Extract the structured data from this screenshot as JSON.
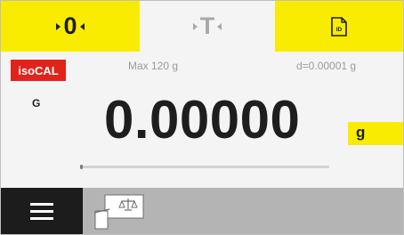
{
  "toolbar": {
    "zero_label": "0",
    "tare_label": "T",
    "id_label": "ID"
  },
  "status": {
    "isocal_label": "isoCAL",
    "max_capacity": "Max 120 g",
    "readability": "d=0.00001 g",
    "weighing_mode": "G"
  },
  "display": {
    "weight": "0.00000",
    "unit": "g",
    "capacity_used_fraction": 0.0
  },
  "colors": {
    "accent_yellow": "#f9ec00",
    "isocal_red": "#e2231a",
    "menu_dark": "#1c1c1c",
    "bottom_bar": "#b4b4b4"
  },
  "icons": {
    "menu": "hamburger-icon",
    "balance": "balance-scale-icon",
    "id": "id-card-icon"
  }
}
